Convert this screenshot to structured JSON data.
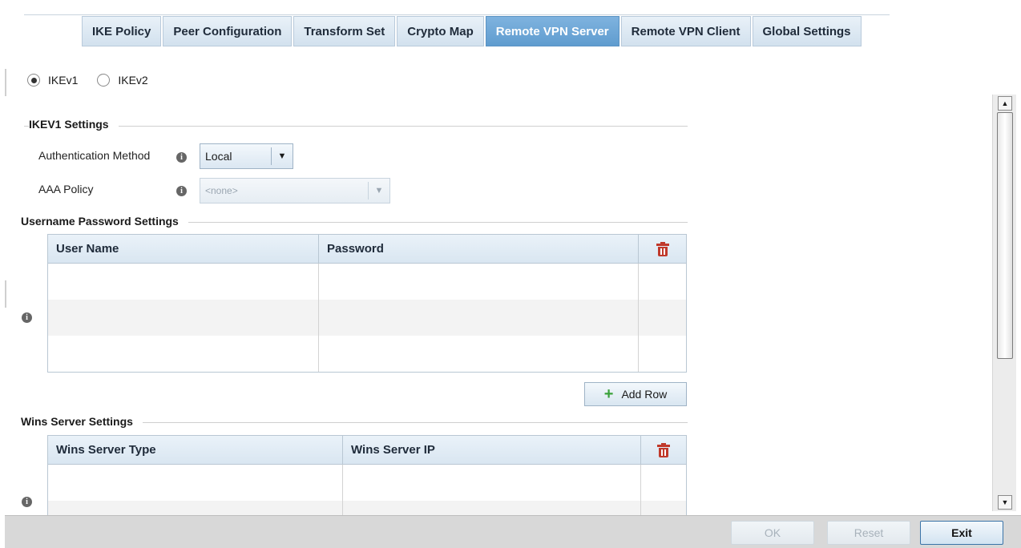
{
  "tabs": [
    {
      "label": "IKE Policy",
      "active": false
    },
    {
      "label": "Peer Configuration",
      "active": false
    },
    {
      "label": "Transform Set",
      "active": false
    },
    {
      "label": "Crypto Map",
      "active": false
    },
    {
      "label": "Remote VPN Server",
      "active": true
    },
    {
      "label": "Remote VPN Client",
      "active": false
    },
    {
      "label": "Global Settings",
      "active": false
    }
  ],
  "ike_version": {
    "options": [
      {
        "label": "IKEv1",
        "selected": true
      },
      {
        "label": "IKEv2",
        "selected": false
      }
    ]
  },
  "ikev1_settings": {
    "title": "IKEV1 Settings",
    "auth_method": {
      "label": "Authentication Method",
      "value": "Local"
    },
    "aaa_policy": {
      "label": "AAA Policy",
      "value": "<none>",
      "disabled": true
    }
  },
  "username_password": {
    "title": "Username Password Settings",
    "columns": [
      "User Name",
      "Password"
    ],
    "rows": [],
    "add_row_label": "Add Row"
  },
  "wins_server": {
    "title": "Wins Server Settings",
    "columns": [
      "Wins Server Type",
      "Wins Server IP"
    ],
    "rows": []
  },
  "footer": {
    "ok_label": "OK",
    "reset_label": "Reset",
    "exit_label": "Exit"
  },
  "colors": {
    "active_tab": "#6aa7d8",
    "delete_icon": "#c0392b",
    "add_icon": "#3aa13a"
  }
}
